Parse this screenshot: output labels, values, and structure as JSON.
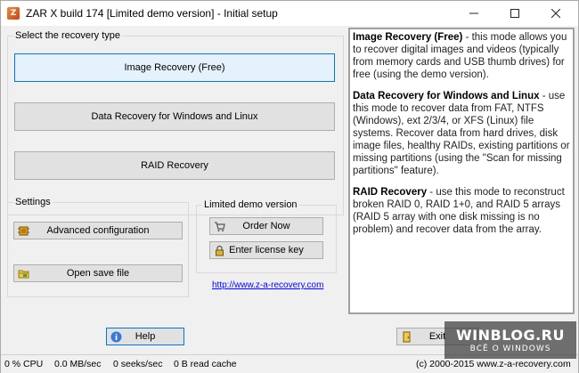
{
  "window": {
    "title": "ZAR X build 174 [Limited demo version] - Initial setup",
    "app_icon_glyph": "Z"
  },
  "recovery": {
    "group_label": "Select the recovery type",
    "image_btn": "Image Recovery (Free)",
    "data_btn": "Data Recovery for Windows and Linux",
    "raid_btn": "RAID Recovery"
  },
  "settings": {
    "group_label": "Settings",
    "advanced_btn": "Advanced configuration",
    "save_btn": "Open save file"
  },
  "demo": {
    "group_label": "Limited demo version",
    "order_btn": "Order Now",
    "license_btn": "Enter license key",
    "link": "http://www.z-a-recovery.com"
  },
  "description": {
    "p1_title": "Image Recovery (Free)",
    "p1_body": " - this mode allows you to recover digital images and videos (typically from memory cards and USB thumb drives) for free (using the demo version).",
    "p2_title": "Data Recovery for Windows and Linux",
    "p2_body": " - use this mode to recover data from FAT, NTFS (Windows), ext 2/3/4, or XFS (Linux) file systems. Recover data from hard drives, disk image files, healthy RAIDs, existing partitions or missing partitions (using the \"Scan for missing partitions\" feature).",
    "p3_title": "RAID Recovery",
    "p3_body": " - use this mode to reconstruct broken RAID 0, RAID 1+0, and RAID 5 arrays (RAID 5 array with one disk missing is no problem) and recover data from the array."
  },
  "footer": {
    "help_btn": "Help",
    "exit_btn": "Exit"
  },
  "status": {
    "cpu": "0 % CPU",
    "speed": "0.0 MB/sec",
    "seeks": "0 seeks/sec",
    "read_cache": "0 B read cache",
    "copyright": "(c) 2000-2015 www.z-a-recovery.com"
  },
  "watermark": {
    "line1": "WINBLOG.RU",
    "line2": "ВСЁ О WINDOWS"
  }
}
